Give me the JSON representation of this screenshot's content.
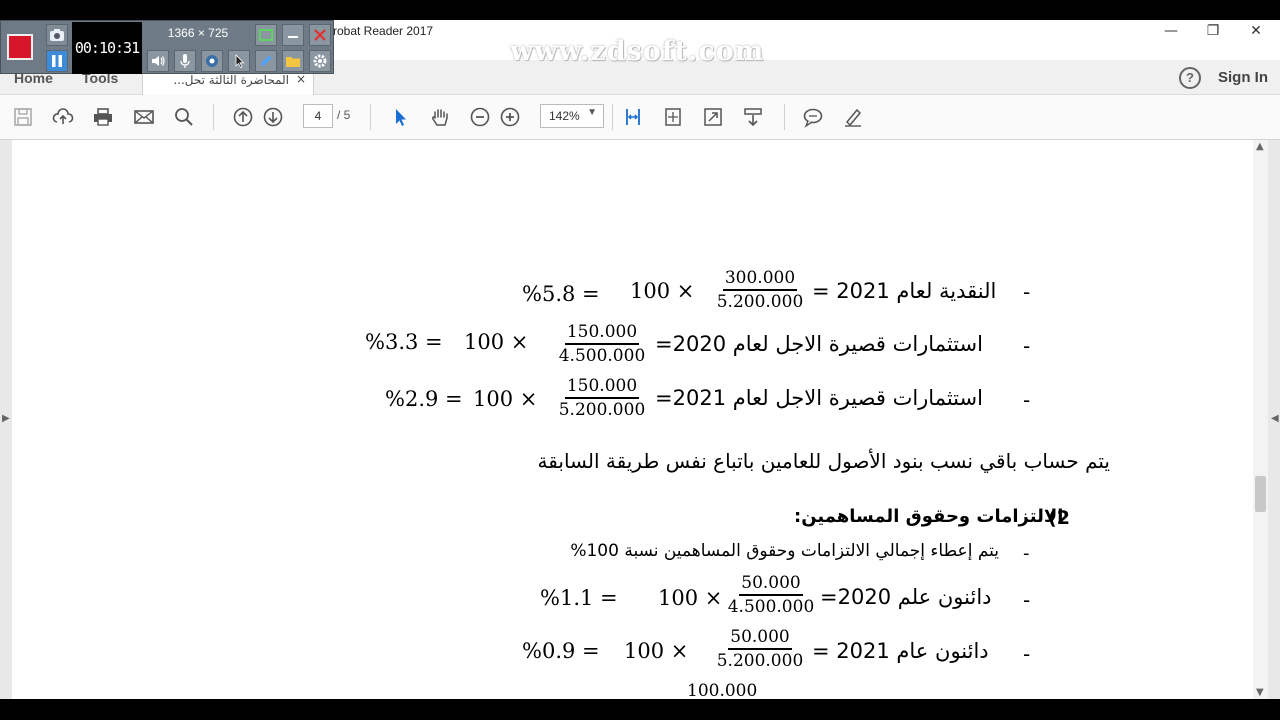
{
  "window": {
    "title": "robat Reader 2017",
    "minimize": "—",
    "restore": "❐",
    "close": "✕"
  },
  "nav": {
    "home": "Home",
    "tools": "Tools",
    "doc_tab": "المحاضرة الثالثة تحل...",
    "doc_tab_close": "×",
    "help": "?",
    "sign_in": "Sign In"
  },
  "toolbar": {
    "page_current": "4",
    "page_total": "/ 5",
    "zoom": "142%"
  },
  "recorder": {
    "time": "00:10:31",
    "resolution": "1366 × 725",
    "watermark": "www.zdsoft.com"
  },
  "document": {
    "line1": {
      "bullet": "-",
      "label": "النقدية لعام 2021 =",
      "num": "300.000",
      "den": "5.200.000",
      "mult": "100  ×",
      "result": "%5.8  ="
    },
    "line2": {
      "bullet": "-",
      "label": "استثمارات قصيرة الاجل لعام 2020=",
      "num": "150.000",
      "den": "4.500.000",
      "mult": "100  ×",
      "result": "%3.3  ="
    },
    "line3": {
      "bullet": "-",
      "label": "استثمارات قصيرة الاجل لعام 2021=",
      "num": "150.000",
      "den": "5.200.000",
      "mult": "100  ×",
      "result": "%2.9  ="
    },
    "note": "يتم حساب باقي نسب بنود الأصول للعامين باتباع نفس طريقة السابقة",
    "section_num": "2)",
    "section_title": "الالتزامات وحقوق المساهمين:",
    "line4": {
      "bullet": "-",
      "text": "يتم إعطاء إجمالي الالتزامات وحقوق المساهمين نسبة 100%"
    },
    "line5": {
      "bullet": "-",
      "label": "دائنون علم 2020=",
      "num": "50.000",
      "den": "4.500.000",
      "mult": "100 ×",
      "result": "%1.1  ="
    },
    "line6": {
      "bullet": "-",
      "label": "دائنون عام 2021 =",
      "num": "50.000",
      "den": "5.200.000",
      "mult": "100  ×",
      "result": "%0.9  ="
    },
    "line7": {
      "num": "100.000"
    }
  }
}
